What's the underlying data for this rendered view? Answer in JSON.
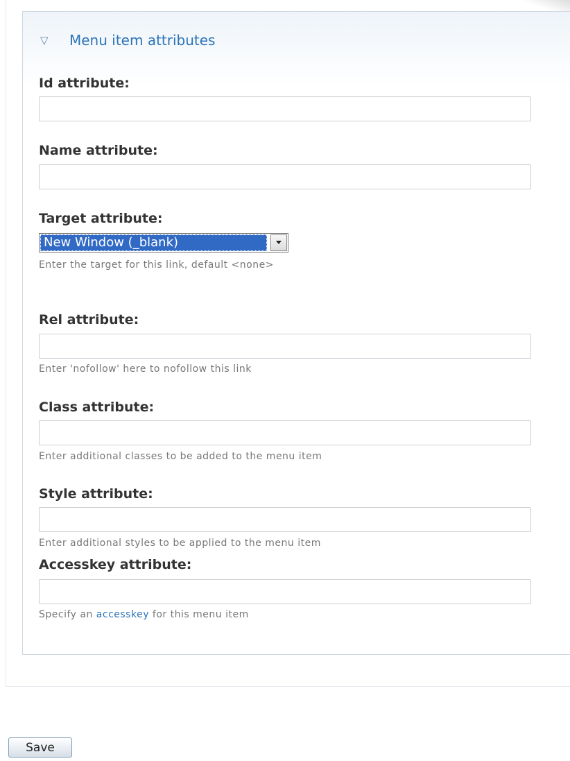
{
  "fieldset": {
    "legend": "Menu item attributes",
    "collapse_icon": "triangle-down-icon"
  },
  "fields": {
    "id": {
      "label": "Id attribute:",
      "value": ""
    },
    "name": {
      "label": "Name attribute:",
      "value": ""
    },
    "target": {
      "label": "Target attribute:",
      "selected": "New Window (_blank)",
      "description": "Enter the target for this link, default <none>"
    },
    "rel": {
      "label": "Rel attribute:",
      "value": "",
      "description": "Enter 'nofollow' here to nofollow this link"
    },
    "class": {
      "label": "Class attribute:",
      "value": "",
      "description": "Enter additional classes to be added to the menu item"
    },
    "style": {
      "label": "Style attribute:",
      "value": "",
      "description": "Enter additional styles to be applied to the menu item"
    },
    "accesskey": {
      "label": "Accesskey attribute:",
      "value": "",
      "description_before": "Specify an ",
      "description_link": "accesskey",
      "description_after": " for this menu item"
    }
  },
  "actions": {
    "save_label": "Save"
  },
  "colors": {
    "link": "#2b74b8",
    "select_highlight": "#316ac5",
    "label": "#333333",
    "description": "#777777"
  }
}
